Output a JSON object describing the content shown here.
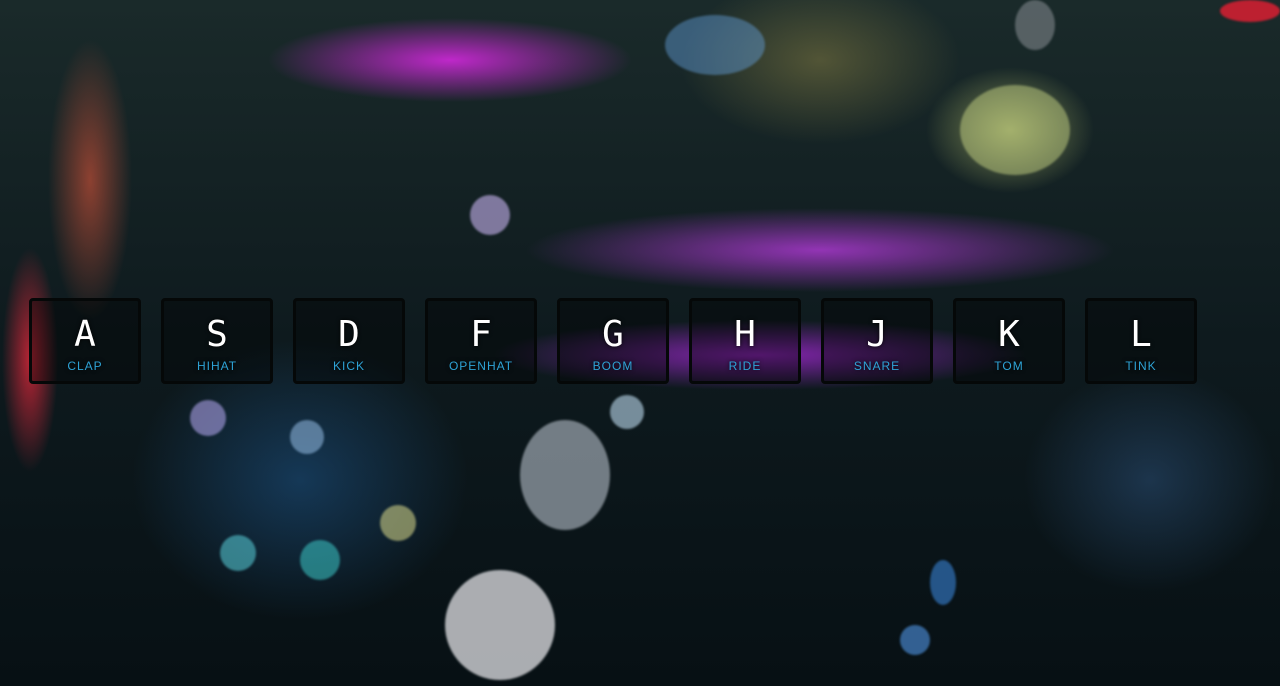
{
  "keys": [
    {
      "key": "A",
      "sound": "CLAP"
    },
    {
      "key": "S",
      "sound": "HIHAT"
    },
    {
      "key": "D",
      "sound": "KICK"
    },
    {
      "key": "F",
      "sound": "OPENHAT"
    },
    {
      "key": "G",
      "sound": "BOOM"
    },
    {
      "key": "H",
      "sound": "RIDE"
    },
    {
      "key": "J",
      "sound": "SNARE"
    },
    {
      "key": "K",
      "sound": "TOM"
    },
    {
      "key": "L",
      "sound": "TINK"
    }
  ],
  "colors": {
    "key_letter": "#ffffff",
    "sound_label": "#2ea3d6",
    "key_border": "#050808"
  },
  "background": {
    "image": "drum-kit-photo"
  }
}
